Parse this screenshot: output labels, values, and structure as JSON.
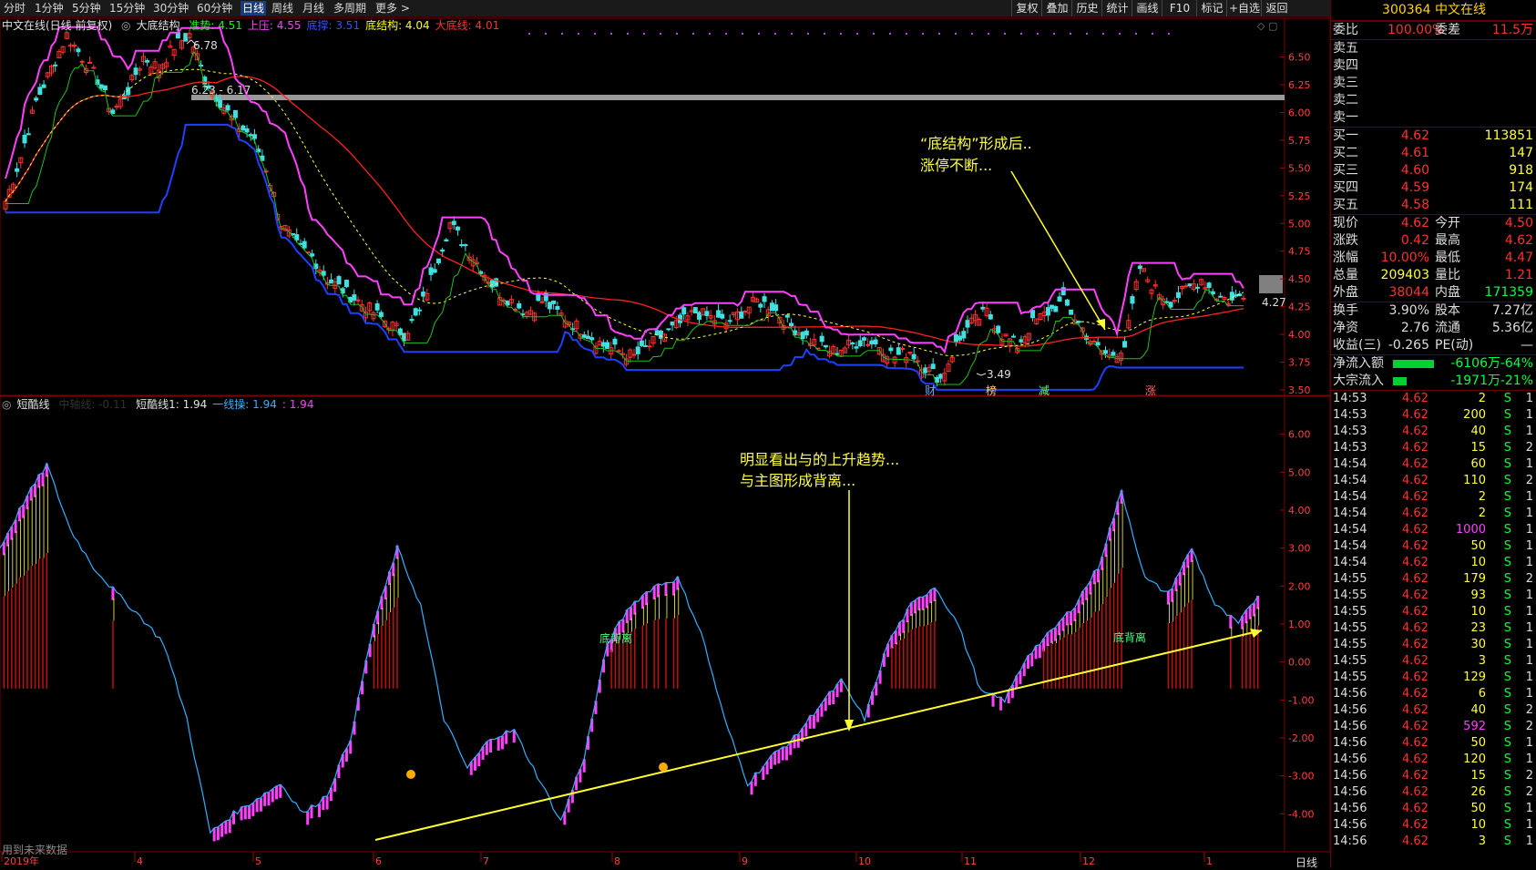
{
  "toolbar": {
    "periods": [
      "分时",
      "1分钟",
      "5分钟",
      "15分钟",
      "30分钟",
      "60分钟",
      "日线",
      "周线",
      "月线",
      "多周期",
      "更多 >"
    ],
    "active_period": "日线",
    "buttons": [
      "复权",
      "叠加",
      "历史",
      "统计",
      "画线",
      "F10",
      "标记",
      "+自选",
      "返回"
    ]
  },
  "main_legend": {
    "stock": "中文在线(日线 前复权)",
    "indicator": "大底结构",
    "items": [
      {
        "label": "准势: 4.51",
        "color": "#00ff00"
      },
      {
        "label": "上压: 4.55",
        "color": "#ff40ff"
      },
      {
        "label": "底撑: 3.51",
        "color": "#3050ff"
      },
      {
        "label": "底结构: 4.04",
        "color": "#ffff00"
      },
      {
        "label": "大底线: 4.01",
        "color": "#ff3030"
      }
    ]
  },
  "sub_legend": {
    "name": "短酷线",
    "faded": "中轴线: -0.11",
    "items": [
      {
        "label": "短酷线1: 1.94",
        "color": "#e0e0e0"
      },
      {
        "label": "一线操: 1.94",
        "color": "#30b0ff"
      },
      {
        "label": ": 1.94",
        "color": "#ff40ff"
      }
    ]
  },
  "main_axis": [
    "6.50",
    "6.25",
    "6.00",
    "5.75",
    "5.50",
    "5.25",
    "5.00",
    "4.75",
    "4.50",
    "4.25",
    "4.00",
    "3.75",
    "3.50"
  ],
  "sub_axis": [
    "6.00",
    "5.00",
    "4.00",
    "3.00",
    "2.00",
    "1.00",
    "0.00",
    "-1.00",
    "-2.00",
    "-3.00",
    "-4.00"
  ],
  "x_axis": [
    "2019年",
    "4",
    "5",
    "6",
    "7",
    "8",
    "9",
    "10",
    "11",
    "12",
    "1"
  ],
  "x_axis_corner": "日线",
  "price_marks": {
    "high": "6.78",
    "low": "3.49",
    "range": "6.23 - 6.17",
    "last": "4.27"
  },
  "event_tags": [
    {
      "text": "财",
      "color": "#6fa8ff"
    },
    {
      "text": "榜",
      "color": "#ffcc66"
    },
    {
      "text": "减",
      "color": "#66ff66"
    },
    {
      "text": "涨",
      "color": "#ff6060"
    }
  ],
  "annotations": {
    "main": [
      "“底结构”形成后..",
      "涨停不断..."
    ],
    "sub": [
      "明显看出与的上升趋势...",
      "与主图形成背离..."
    ],
    "div1": "底背离",
    "div2": "底背离",
    "footer": "用到未来数据"
  },
  "quote": {
    "code_name": "300364 中文在线",
    "weibi": {
      "label": "委比",
      "value": "100.00%",
      "label2": "委差",
      "value2": "11.5万"
    },
    "sells": [
      {
        "label": "卖五",
        "price": "",
        "vol": ""
      },
      {
        "label": "卖四",
        "price": "",
        "vol": ""
      },
      {
        "label": "卖三",
        "price": "",
        "vol": ""
      },
      {
        "label": "卖二",
        "price": "",
        "vol": ""
      },
      {
        "label": "卖一",
        "price": "",
        "vol": ""
      }
    ],
    "buys": [
      {
        "label": "买一",
        "price": "4.62",
        "vol": "113851"
      },
      {
        "label": "买二",
        "price": "4.61",
        "vol": "147"
      },
      {
        "label": "买三",
        "price": "4.60",
        "vol": "918"
      },
      {
        "label": "买四",
        "price": "4.59",
        "vol": "174"
      },
      {
        "label": "买五",
        "price": "4.58",
        "vol": "111"
      }
    ],
    "stats": [
      {
        "l1": "现价",
        "v1": "4.62",
        "c1": "#ff3030",
        "l2": "今开",
        "v2": "4.50",
        "c2": "#ff3030"
      },
      {
        "l1": "涨跌",
        "v1": "0.42",
        "c1": "#ff3030",
        "l2": "最高",
        "v2": "4.62",
        "c2": "#ff3030"
      },
      {
        "l1": "涨幅",
        "v1": "10.00%",
        "c1": "#ff3030",
        "l2": "最低",
        "v2": "4.47",
        "c2": "#ff3030"
      },
      {
        "l1": "总量",
        "v1": "209403",
        "c1": "#ffff40",
        "l2": "量比",
        "v2": "1.21",
        "c2": "#ff3030"
      },
      {
        "l1": "外盘",
        "v1": "38044",
        "c1": "#ff3030",
        "l2": "内盘",
        "v2": "171359",
        "c2": "#00ff40"
      }
    ],
    "stats2": [
      {
        "l1": "换手",
        "v1": "3.90%",
        "l2": "股本",
        "v2": "7.27亿"
      },
      {
        "l1": "净资",
        "v1": "2.76",
        "l2": "流通",
        "v2": "5.36亿"
      },
      {
        "l1": "收益(三)",
        "v1": "-0.265",
        "l2": "PE(动)",
        "v2": "—"
      }
    ],
    "flows": [
      {
        "label": "净流入额",
        "value": "-6106万",
        "pct": "-64%",
        "bar": 0.64
      },
      {
        "label": "大宗流入",
        "value": "-1971万",
        "pct": "-21%",
        "bar": 0.21
      }
    ]
  },
  "ticks": [
    {
      "t": "14:53",
      "p": "4.62",
      "v": "2",
      "s": "S",
      "n": "1"
    },
    {
      "t": "14:53",
      "p": "4.62",
      "v": "200",
      "s": "S",
      "n": "1"
    },
    {
      "t": "14:53",
      "p": "4.62",
      "v": "40",
      "s": "S",
      "n": "1"
    },
    {
      "t": "14:53",
      "p": "4.62",
      "v": "15",
      "s": "S",
      "n": "2"
    },
    {
      "t": "14:54",
      "p": "4.62",
      "v": "60",
      "s": "S",
      "n": "1"
    },
    {
      "t": "14:54",
      "p": "4.62",
      "v": "110",
      "s": "S",
      "n": "2"
    },
    {
      "t": "14:54",
      "p": "4.62",
      "v": "2",
      "s": "S",
      "n": "1"
    },
    {
      "t": "14:54",
      "p": "4.62",
      "v": "2",
      "s": "S",
      "n": "1"
    },
    {
      "t": "14:54",
      "p": "4.62",
      "v": "1000",
      "s": "S",
      "n": "1"
    },
    {
      "t": "14:54",
      "p": "4.62",
      "v": "50",
      "s": "S",
      "n": "1"
    },
    {
      "t": "14:54",
      "p": "4.62",
      "v": "10",
      "s": "S",
      "n": "1"
    },
    {
      "t": "14:55",
      "p": "4.62",
      "v": "179",
      "s": "S",
      "n": "2"
    },
    {
      "t": "14:55",
      "p": "4.62",
      "v": "93",
      "s": "S",
      "n": "1"
    },
    {
      "t": "14:55",
      "p": "4.62",
      "v": "10",
      "s": "S",
      "n": "1"
    },
    {
      "t": "14:55",
      "p": "4.62",
      "v": "23",
      "s": "S",
      "n": "1"
    },
    {
      "t": "14:55",
      "p": "4.62",
      "v": "30",
      "s": "S",
      "n": "1"
    },
    {
      "t": "14:55",
      "p": "4.62",
      "v": "3",
      "s": "S",
      "n": "1"
    },
    {
      "t": "14:55",
      "p": "4.62",
      "v": "129",
      "s": "S",
      "n": "1"
    },
    {
      "t": "14:56",
      "p": "4.62",
      "v": "6",
      "s": "S",
      "n": "1"
    },
    {
      "t": "14:56",
      "p": "4.62",
      "v": "40",
      "s": "S",
      "n": "2"
    },
    {
      "t": "14:56",
      "p": "4.62",
      "v": "592",
      "s": "S",
      "n": "2"
    },
    {
      "t": "14:56",
      "p": "4.62",
      "v": "50",
      "s": "S",
      "n": "1"
    },
    {
      "t": "14:56",
      "p": "4.62",
      "v": "120",
      "s": "S",
      "n": "1"
    },
    {
      "t": "14:56",
      "p": "4.62",
      "v": "15",
      "s": "S",
      "n": "2"
    },
    {
      "t": "14:56",
      "p": "4.62",
      "v": "26",
      "s": "S",
      "n": "2"
    },
    {
      "t": "14:56",
      "p": "4.62",
      "v": "50",
      "s": "S",
      "n": "1"
    },
    {
      "t": "14:56",
      "p": "4.62",
      "v": "10",
      "s": "S",
      "n": "1"
    },
    {
      "t": "14:56",
      "p": "4.62",
      "v": "3",
      "s": "S",
      "n": "1"
    }
  ],
  "chart_data": {
    "type": "line",
    "main_price_axis": {
      "ylim": [
        3.45,
        6.85
      ]
    },
    "sub_axis": {
      "ylim": [
        -5.0,
        7.0
      ]
    },
    "close_path": [
      5.2,
      5.6,
      6.1,
      6.4,
      6.7,
      6.5,
      6.3,
      6.0,
      6.2,
      6.5,
      6.4,
      6.6,
      6.7,
      6.3,
      6.1,
      5.9,
      5.8,
      5.5,
      5.0,
      4.8,
      4.7,
      4.5,
      4.4,
      4.3,
      4.2,
      4.1,
      4.0,
      4.2,
      4.6,
      5.0,
      4.8,
      4.6,
      4.4,
      4.3,
      4.2,
      4.3,
      4.2,
      4.1,
      4.0,
      3.9,
      3.85,
      3.8,
      3.9,
      4.0,
      4.1,
      4.2,
      4.15,
      4.1,
      4.2,
      4.3,
      4.25,
      4.1,
      4.0,
      3.9,
      3.85,
      3.9,
      3.95,
      3.9,
      3.8,
      3.85,
      3.7,
      3.6,
      3.9,
      4.1,
      4.2,
      4.0,
      3.9,
      4.1,
      4.2,
      4.3,
      4.1,
      3.9,
      3.8,
      3.9,
      4.6,
      4.4,
      4.3,
      4.4,
      4.5,
      4.35,
      4.3,
      4.4
    ],
    "sub_path": [
      3.0,
      4.2,
      5.2,
      3.5,
      2.5,
      1.8,
      1.2,
      0.5,
      -1.5,
      -4.5,
      -4.0,
      -3.6,
      -3.2,
      -4.0,
      -3.5,
      -2.0,
      1.0,
      3.0,
      1.5,
      -1.5,
      -2.8,
      -2.0,
      -1.8,
      -3.0,
      -4.2,
      -2.5,
      0.5,
      1.5,
      2.0,
      2.2,
      0.8,
      -1.5,
      -3.2,
      -2.5,
      -2.0,
      -1.2,
      -0.5,
      -1.5,
      0.5,
      1.5,
      2.0,
      1.0,
      -0.8,
      -1.0,
      0.2,
      0.8,
      1.5,
      2.5,
      4.5,
      2.2,
      1.8,
      3.0,
      1.5,
      1.0,
      1.9
    ]
  }
}
